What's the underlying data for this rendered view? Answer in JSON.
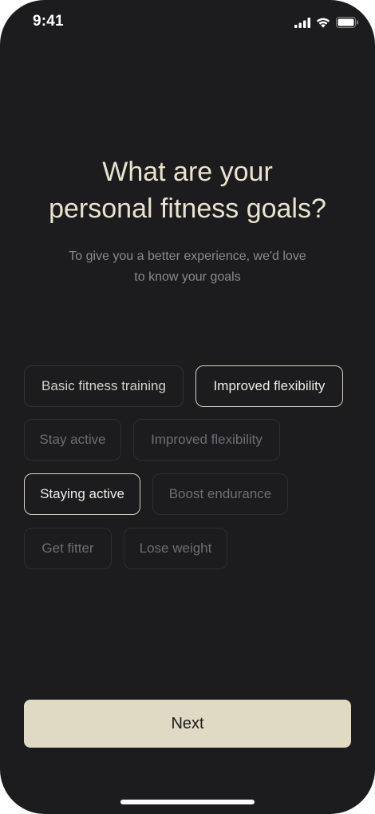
{
  "status_bar": {
    "time": "9:41",
    "icons": [
      "cellular-signal-icon",
      "wifi-icon",
      "battery-icon"
    ]
  },
  "heading": {
    "line1": "What are your",
    "line2": "personal fitness goals?"
  },
  "subheading": {
    "line1": "To give you a better experience, we'd love",
    "line2": "to know your goals"
  },
  "goals": [
    {
      "label": "Basic fitness training",
      "selected": false
    },
    {
      "label": "Improved flexibility",
      "selected": true
    },
    {
      "label": "Stay active",
      "selected": false
    },
    {
      "label": "Improved flexibility",
      "selected": false
    },
    {
      "label": "Staying active",
      "selected": true
    },
    {
      "label": "Boost endurance",
      "selected": false
    },
    {
      "label": "Get fitter",
      "selected": false
    },
    {
      "label": "Lose weight",
      "selected": false
    }
  ],
  "next_button": {
    "label": "Next"
  },
  "colors": {
    "background": "#1c1c1e",
    "accent": "#e0d9c4",
    "heading": "#e9e2cf",
    "muted_text": "#8a8a8e"
  }
}
